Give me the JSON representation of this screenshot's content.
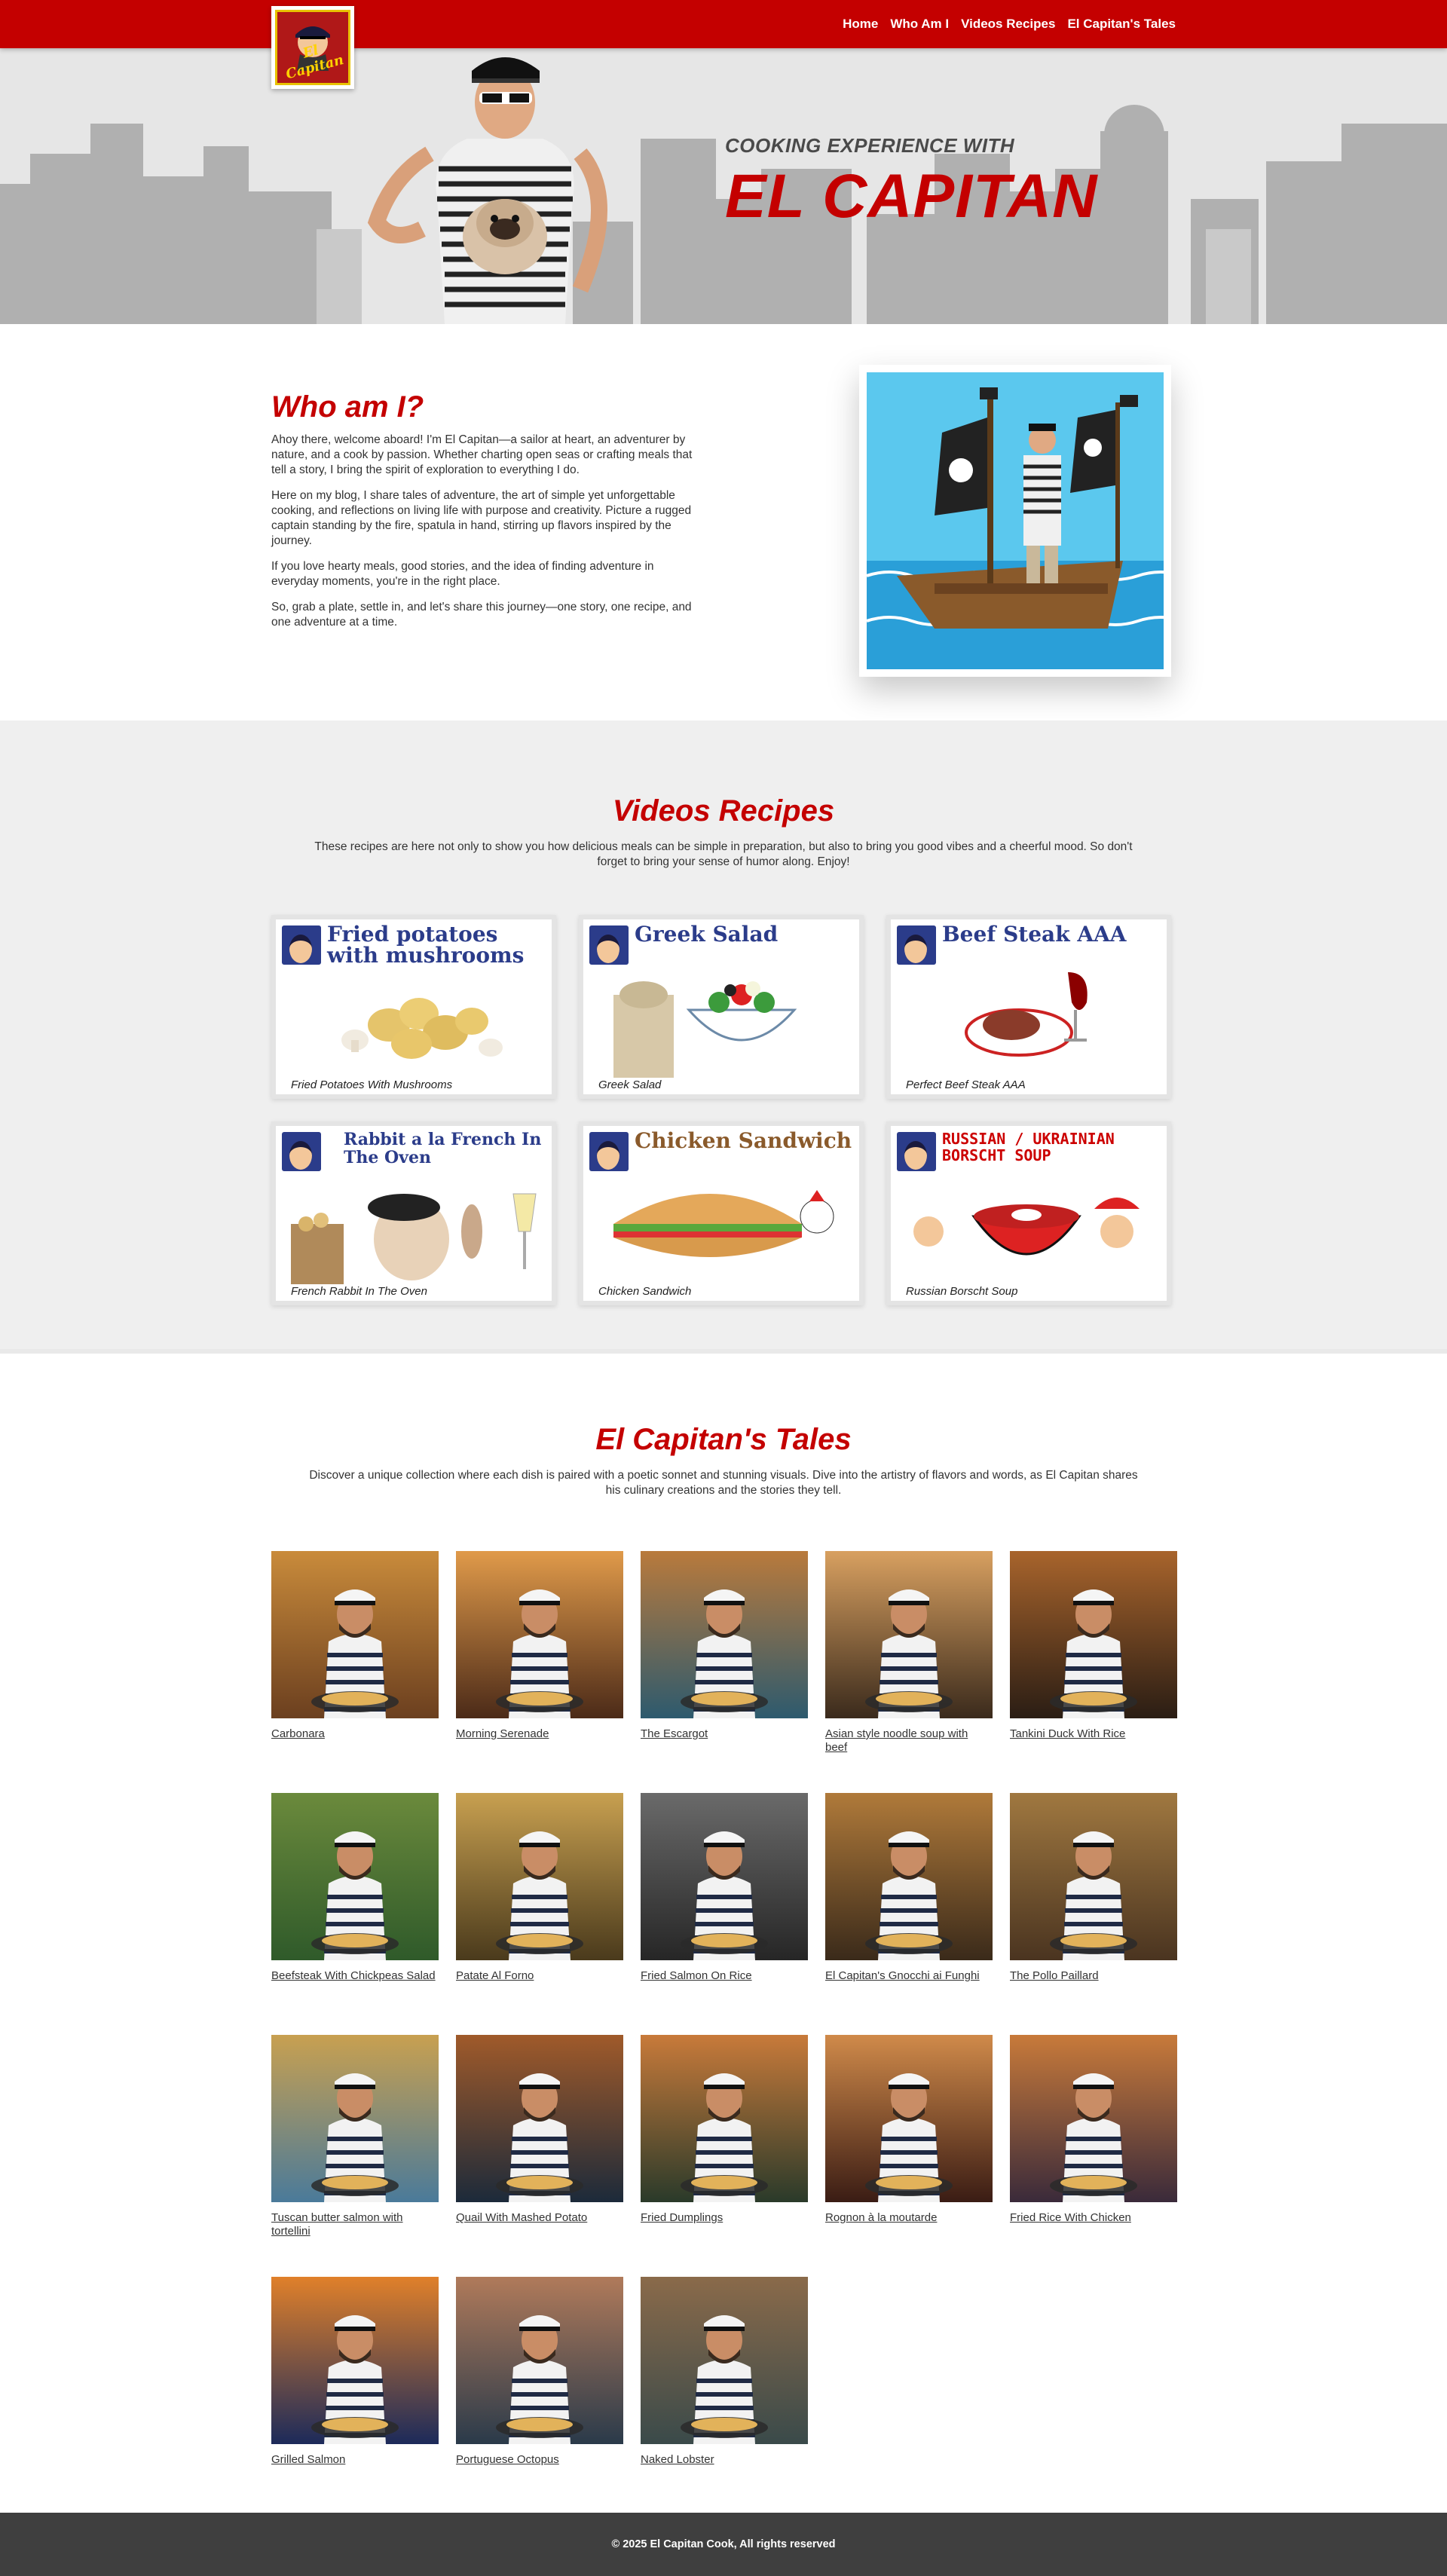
{
  "nav": {
    "logo_text": "El Capitan",
    "links": [
      "Home",
      "Who Am I",
      "Videos Recipes",
      "El Capitan's Tales"
    ]
  },
  "hero": {
    "subtitle": "COOKING EXPERIENCE WITH",
    "title": "EL CAPITAN"
  },
  "who": {
    "title": "Who am I?",
    "paragraphs": [
      "Ahoy there, welcome aboard! I'm El Capitan—a sailor at heart, an adventurer by nature, and a cook by passion. Whether charting open seas or crafting meals that tell a story, I bring the spirit of exploration to everything I do.",
      "Here on my blog, I share tales of adventure, the art of simple yet unforgettable cooking, and reflections on living life with purpose and creativity. Picture a rugged captain standing by the fire, spatula in hand, stirring up flavors inspired by the journey.",
      "If you love hearty meals, good stories, and the idea of finding adventure in everyday moments, you're in the right place.",
      "So, grab a plate, settle in, and let's share this journey—one story, one recipe, and one adventure at a time."
    ]
  },
  "videos": {
    "title": "Videos Recipes",
    "description": "These recipes are here not only to show you how delicious meals can be simple in preparation, but also to bring you good vibes and a cheerful mood. So don't forget to bring your sense of humor along. Enjoy!",
    "cards": [
      {
        "thumb_title": "Fried potatoes with mushrooms",
        "label": "Fried Potatoes With Mushrooms"
      },
      {
        "thumb_title": "Greek Salad",
        "label": "Greek Salad"
      },
      {
        "thumb_title": "Beef Steak AAA",
        "label": "Perfect Beef Steak AAA"
      },
      {
        "thumb_title": "Rabbit a la French In The Oven",
        "label": "French Rabbit In The Oven"
      },
      {
        "thumb_title": "Chicken Sandwich",
        "label": "Chicken Sandwich"
      },
      {
        "thumb_title": "RUSSIAN / UKRAINIAN BORSCHT SOUP",
        "label": "Russian Borscht Soup"
      }
    ]
  },
  "tales": {
    "title": "El Capitan's Tales",
    "description": "Discover a unique collection where each dish is paired with a poetic sonnet and stunning visuals. Dive into the artistry of flavors and words, as El Capitan shares his culinary creations and the stories they tell.",
    "items": [
      "Carbonara",
      "Morning Serenade",
      "The Escargot",
      "Asian style noodle soup with beef",
      "Tankini Duck With Rice",
      "Beefsteak With Chickpeas Salad",
      "Patate Al Forno",
      "Fried Salmon On Rice",
      "El Capitan's Gnocchi ai Funghi",
      "The Pollo Paillard",
      "Tuscan butter salmon with tortellini",
      "Quail With Mashed Potato",
      "Fried Dumplings",
      "Rognon à la moutarde",
      "Fried Rice With Chicken",
      "Grilled Salmon",
      "Portuguese Octopus",
      "Naked Lobster"
    ]
  },
  "footer": {
    "text": "© 2025 El Capitan Cook, All rights reserved"
  },
  "colors": {
    "brand_red": "#c40000",
    "footer_bg": "#3f3f3f",
    "section_gray": "#efefef"
  }
}
